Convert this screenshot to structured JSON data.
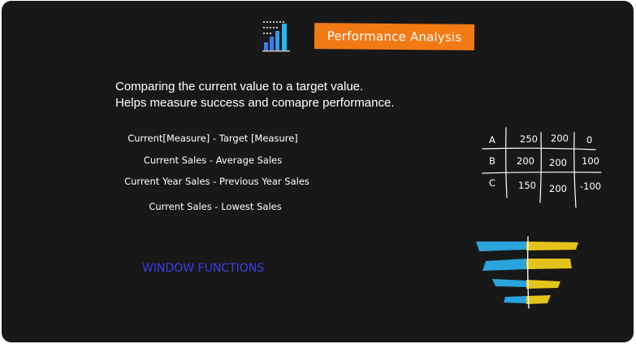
{
  "title": "Performance Analysis",
  "description": [
    "Comparing the current value to a target value.",
    "Helps measure success and comapre performance."
  ],
  "formulas": [
    "Current[Measure] - Target [Measure]",
    "Current Sales  - Average Sales",
    "Current Year Sales - Previous Year Sales",
    "Current Sales - Lowest Sales"
  ],
  "footer_label": "WINDOW FUNCTIONS",
  "table": {
    "rows": [
      {
        "label": "A",
        "current": "250",
        "target": "200",
        "diff": "0"
      },
      {
        "label": "B",
        "current": "200",
        "target": "200",
        "diff": "100"
      },
      {
        "label": "C",
        "current": "150",
        "target": "200",
        "diff": "-100"
      }
    ]
  },
  "icons": {
    "logo": "bar-chart-icon",
    "diverging": "diverging-bar-icon"
  },
  "colors": {
    "background": "#181818",
    "banner": "#f27a14",
    "accent_blue": "#2aa4dc",
    "accent_yellow": "#e4c41b",
    "window_fn_text": "#3a3ee8"
  }
}
